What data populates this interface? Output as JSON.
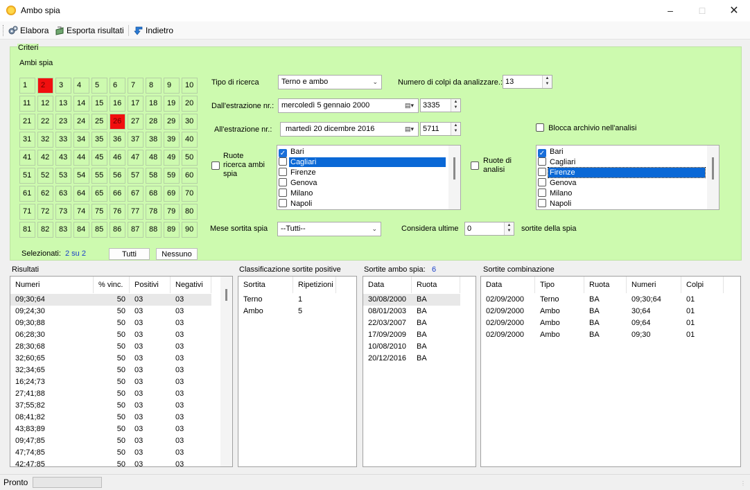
{
  "window": {
    "title": "Ambo spia"
  },
  "toolbar": {
    "elabora": "Elabora",
    "esporta": "Esporta risultati",
    "indietro": "Indietro"
  },
  "criteria": {
    "group_label": "Criteri",
    "ambi_label": "Ambi spia",
    "numbers": [
      1,
      2,
      3,
      4,
      5,
      6,
      7,
      8,
      9,
      10,
      11,
      12,
      13,
      14,
      15,
      16,
      17,
      18,
      19,
      20,
      21,
      22,
      23,
      24,
      25,
      26,
      27,
      28,
      29,
      30,
      31,
      32,
      33,
      34,
      35,
      36,
      37,
      38,
      39,
      40,
      41,
      42,
      43,
      44,
      45,
      46,
      47,
      48,
      49,
      50,
      51,
      52,
      53,
      54,
      55,
      56,
      57,
      58,
      59,
      60,
      61,
      62,
      63,
      64,
      65,
      66,
      67,
      68,
      69,
      70,
      71,
      72,
      73,
      74,
      75,
      76,
      77,
      78,
      79,
      80,
      81,
      82,
      83,
      84,
      85,
      86,
      87,
      88,
      89,
      90
    ],
    "selected_numbers": [
      2,
      26
    ],
    "selezionati_label": "Selezionati:",
    "selezionati_value": "2 su 2",
    "tutti": "Tutti",
    "nessuno": "Nessuno",
    "tipo_label": "Tipo di ricerca",
    "tipo_value": "Terno e ambo",
    "colpi_label": "Numero di colpi da analizzare.:",
    "colpi_value": "13",
    "dall_label": "Dall'estrazione nr.:",
    "dall_date": "mercoledì   5  gennaio  2000",
    "dall_nr": "3335",
    "all_label": "All'estrazione nr.:",
    "all_date": "martedì  20 dicembre 2016",
    "all_nr": "5711",
    "blocca_label": "Blocca archivio nell'analisi",
    "ruote_ricerca_label": "Ruote ricerca ambi spia",
    "ruote_analisi_label": "Ruote di analisi",
    "ruote_ricerca": [
      {
        "name": "Bari",
        "checked": true
      },
      {
        "name": "Cagliari",
        "checked": false
      },
      {
        "name": "Firenze",
        "checked": false
      },
      {
        "name": "Genova",
        "checked": false
      },
      {
        "name": "Milano",
        "checked": false
      },
      {
        "name": "Napoli",
        "checked": false
      }
    ],
    "ruote_analisi": [
      {
        "name": "Bari",
        "checked": true
      },
      {
        "name": "Cagliari",
        "checked": false
      },
      {
        "name": "Firenze",
        "checked": false
      },
      {
        "name": "Genova",
        "checked": false
      },
      {
        "name": "Milano",
        "checked": false
      },
      {
        "name": "Napoli",
        "checked": false
      }
    ],
    "mese_label": "Mese sortita spia",
    "mese_value": "--Tutti--",
    "considera_label": "Considera ultime",
    "considera_value": "0",
    "sortite_label": "sortite della spia"
  },
  "risultati": {
    "label": "Risultati",
    "columns": [
      "Numeri",
      "% vinc.",
      "Positivi",
      "Negativi"
    ],
    "rows": [
      [
        "09;30;64",
        "50",
        "03",
        "03"
      ],
      [
        "09;24;30",
        "50",
        "03",
        "03"
      ],
      [
        "09;30;88",
        "50",
        "03",
        "03"
      ],
      [
        "06;28;30",
        "50",
        "03",
        "03"
      ],
      [
        "28;30;68",
        "50",
        "03",
        "03"
      ],
      [
        "32;60;65",
        "50",
        "03",
        "03"
      ],
      [
        "32;34;65",
        "50",
        "03",
        "03"
      ],
      [
        "16;24;73",
        "50",
        "03",
        "03"
      ],
      [
        "27;41;88",
        "50",
        "03",
        "03"
      ],
      [
        "37;55;82",
        "50",
        "03",
        "03"
      ],
      [
        "08;41;82",
        "50",
        "03",
        "03"
      ],
      [
        "43;83;89",
        "50",
        "03",
        "03"
      ],
      [
        "09;47;85",
        "50",
        "03",
        "03"
      ],
      [
        "47;74;85",
        "50",
        "03",
        "03"
      ],
      [
        "42;47;85",
        "50",
        "03",
        "03"
      ]
    ]
  },
  "classificazione": {
    "label": "Classificazione sortite positive",
    "columns": [
      "Sortita",
      "Ripetizioni"
    ],
    "rows": [
      [
        "Terno",
        "1"
      ],
      [
        "Ambo",
        "5"
      ]
    ]
  },
  "sortite_spia": {
    "label": "Sortite ambo spia:",
    "count": "6",
    "columns": [
      "Data",
      "Ruota"
    ],
    "rows": [
      [
        "30/08/2000",
        "BA"
      ],
      [
        "08/01/2003",
        "BA"
      ],
      [
        "22/03/2007",
        "BA"
      ],
      [
        "17/09/2009",
        "BA"
      ],
      [
        "10/08/2010",
        "BA"
      ],
      [
        "20/12/2016",
        "BA"
      ]
    ]
  },
  "sortite_comb": {
    "label": "Sortite combinazione",
    "columns": [
      "Data",
      "Tipo",
      "Ruota",
      "Numeri",
      "Colpi"
    ],
    "rows": [
      [
        "02/09/2000",
        "Terno",
        "BA",
        "09;30;64",
        "01"
      ],
      [
        "02/09/2000",
        "Ambo",
        "BA",
        "30;64",
        "01"
      ],
      [
        "02/09/2000",
        "Ambo",
        "BA",
        "09;64",
        "01"
      ],
      [
        "02/09/2000",
        "Ambo",
        "BA",
        "09;30",
        "01"
      ]
    ]
  },
  "status": {
    "text": "Pronto"
  }
}
